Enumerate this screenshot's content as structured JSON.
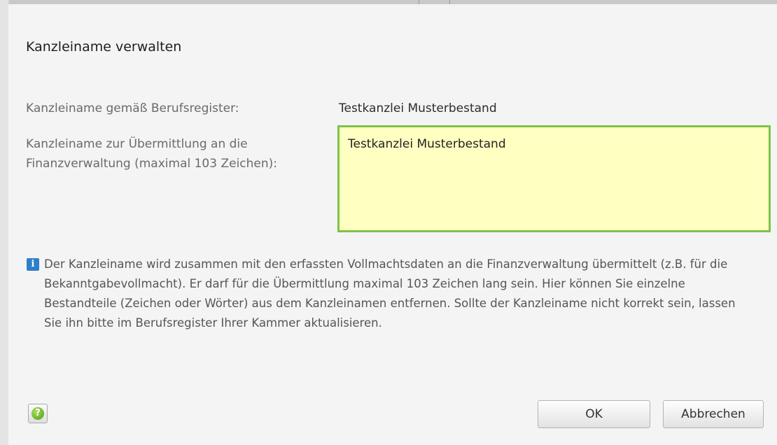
{
  "dialog": {
    "title": "Kanzleiname verwalten",
    "register_label": "Kanzleiname gemäß Berufsregister:",
    "register_value": "Testkanzlei Musterbestand",
    "transmission_label_line1": "Kanzleiname zur Übermittlung an die",
    "transmission_label_line2": "Finanzverwaltung (maximal 103 Zeichen):",
    "transmission_value": "Testkanzlei Musterbestand",
    "info_icon": "info-icon",
    "info_text": "Der Kanzleiname wird zusammen mit den erfassten Vollmachtsdaten an die Finanzverwaltung übermittelt (z.B. für die Bekanntgabevollmacht). Er darf für die Übermittlung maximal 103 Zeichen lang sein. Hier können Sie einzelne Bestandteile (Zeichen oder Wörter) aus dem Kanzleinamen entfernen. Sollte der Kanzleiname nicht korrekt sein, lassen Sie ihn bitte im Berufsregister Ihrer Kammer aktualisieren.",
    "help_icon": "help-icon",
    "ok_label": "OK",
    "cancel_label": "Abbrechen"
  },
  "colors": {
    "input_background": "#ffffc2",
    "input_border": "#7fc24a",
    "info_icon": "#2f7fc8"
  }
}
